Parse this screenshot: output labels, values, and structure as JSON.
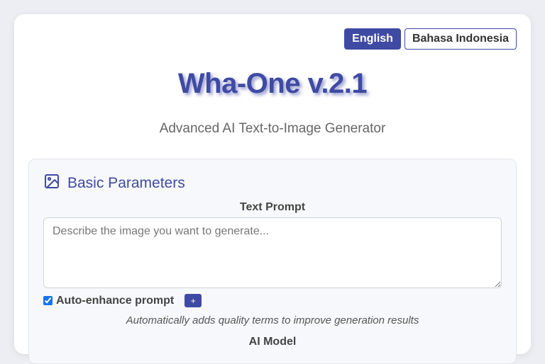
{
  "lang": {
    "english": "English",
    "indonesian": "Bahasa Indonesia"
  },
  "header": {
    "title": "Wha-One v.2.1",
    "subtitle": "Advanced AI Text-to-Image Generator"
  },
  "basic": {
    "section_title": "Basic Parameters",
    "section_icon": "image-icon",
    "prompt_label": "Text Prompt",
    "prompt_placeholder": "Describe the image you want to generate...",
    "prompt_value": "",
    "enhance_label": "Auto-enhance prompt",
    "enhance_checked": true,
    "enhance_button": "+",
    "enhance_hint": "Automatically adds quality terms to improve generation results",
    "model_label": "AI Model"
  },
  "colors": {
    "accent": "#3f4aa3",
    "background": "#eceef3",
    "panel": "#f7f8fb"
  }
}
